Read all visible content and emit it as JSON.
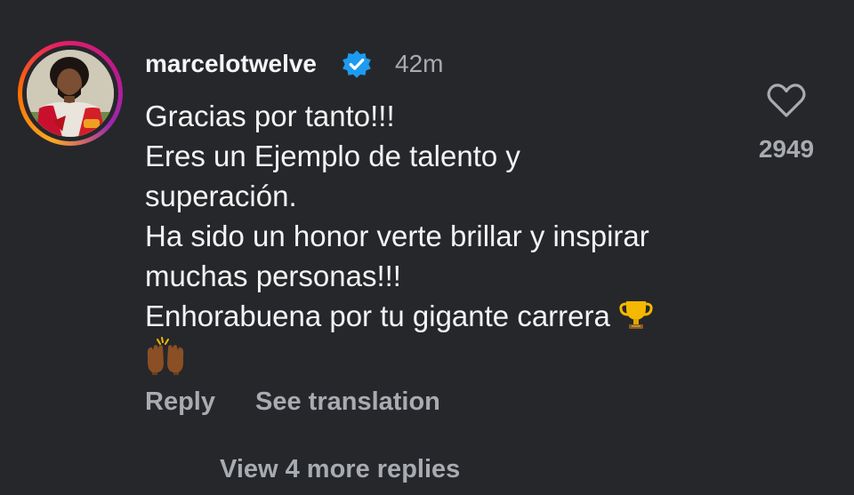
{
  "comment": {
    "username": "marcelotwelve",
    "verified": true,
    "time": "42m",
    "lines": [
      "Gracias por tanto!!!",
      "Eres un Ejemplo de talento y",
      "superación.",
      "Ha sido un honor verte brillar y inspirar",
      "muchas personas!!!",
      "Enhorabuena por tu gigante carrera"
    ],
    "trophy_emoji": "trophy-icon",
    "hands_emoji": "raising-hands-icon",
    "like_count": "2949",
    "reply_label": "Reply",
    "translate_label": "See translation",
    "more_replies_label": "View 4 more replies"
  },
  "colors": {
    "background": "#26272b",
    "text": "#f3f3f3",
    "muted": "#a8abb0",
    "verified": "#1d9bf0"
  }
}
